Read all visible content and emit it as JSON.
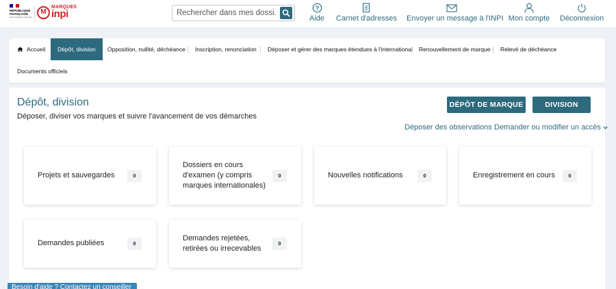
{
  "header": {
    "republique": [
      "RÉPUBLIQUE",
      "FRANÇAISE"
    ],
    "motto": "Liberté Égalité Fraternité",
    "inpi_marques": "MARQUES",
    "inpi_word": "inpi",
    "search_placeholder": "Rechercher dans mes dossi...",
    "nav": [
      {
        "label": "Aide",
        "icon": "help-icon"
      },
      {
        "label": "Carnet d'adresses",
        "icon": "address-book-icon"
      },
      {
        "label": "Envoyer un message à l'INPI",
        "icon": "mail-icon"
      },
      {
        "label": "Mon compte",
        "icon": "user-icon"
      },
      {
        "label": "Déconnexion",
        "icon": "power-icon"
      }
    ]
  },
  "tabs": [
    {
      "label": "Accueil",
      "icon": "home-icon"
    },
    {
      "label": "Dépôt, division",
      "active": true
    },
    {
      "label": "Opposition, nullité, déchéance"
    },
    {
      "label": "Inscription, renonciation"
    },
    {
      "label": "Déposer et gérer des marques étendues à l'international"
    },
    {
      "label": "Renouvellement de marque"
    },
    {
      "label": "Relevé de déchéance"
    },
    {
      "label": "Documents officiels"
    }
  ],
  "main": {
    "title": "Dépôt, division",
    "subtitle": "Déposer, diviser vos marques et suivre l'avancement de vos démarches",
    "btn_depot": "DÉPÔT DE MARQUE",
    "btn_division": "DIVISION",
    "link_observations": "Déposer des observations",
    "link_acces": "Demander ou modifier un accès"
  },
  "cards": [
    {
      "label": "Projets et sauvegardes",
      "count": "0"
    },
    {
      "label": "Dossiers en cours d'examen (y compris marques internationales)",
      "count": "0"
    },
    {
      "label": "Nouvelles notifications",
      "count": "0"
    },
    {
      "label": "Enregistrement en cours",
      "count": "0"
    },
    {
      "label": "Demandes publiées",
      "count": "0"
    },
    {
      "label": "Demandes rejetées, retirées ou irrecevables",
      "count": "0"
    }
  ],
  "bottom_button": "Besoin d'aide ? Contactez un conseiller",
  "colors": {
    "primary": "#2e6a7e",
    "brand_red": "#d81f2a",
    "background": "#eef1f6"
  }
}
